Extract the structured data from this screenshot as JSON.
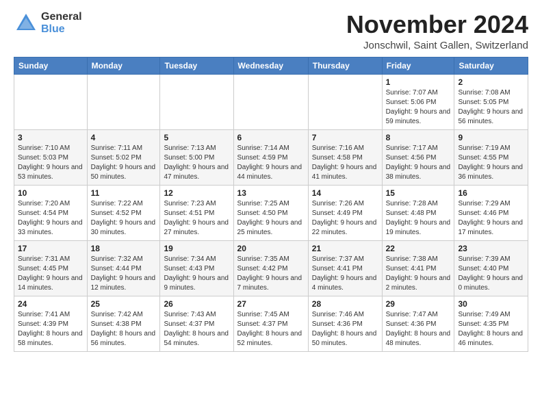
{
  "logo": {
    "general": "General",
    "blue": "Blue"
  },
  "title": "November 2024",
  "location": "Jonschwil, Saint Gallen, Switzerland",
  "weekdays": [
    "Sunday",
    "Monday",
    "Tuesday",
    "Wednesday",
    "Thursday",
    "Friday",
    "Saturday"
  ],
  "weeks": [
    [
      {
        "day": "",
        "info": ""
      },
      {
        "day": "",
        "info": ""
      },
      {
        "day": "",
        "info": ""
      },
      {
        "day": "",
        "info": ""
      },
      {
        "day": "",
        "info": ""
      },
      {
        "day": "1",
        "info": "Sunrise: 7:07 AM\nSunset: 5:06 PM\nDaylight: 9 hours and 59 minutes."
      },
      {
        "day": "2",
        "info": "Sunrise: 7:08 AM\nSunset: 5:05 PM\nDaylight: 9 hours and 56 minutes."
      }
    ],
    [
      {
        "day": "3",
        "info": "Sunrise: 7:10 AM\nSunset: 5:03 PM\nDaylight: 9 hours and 53 minutes."
      },
      {
        "day": "4",
        "info": "Sunrise: 7:11 AM\nSunset: 5:02 PM\nDaylight: 9 hours and 50 minutes."
      },
      {
        "day": "5",
        "info": "Sunrise: 7:13 AM\nSunset: 5:00 PM\nDaylight: 9 hours and 47 minutes."
      },
      {
        "day": "6",
        "info": "Sunrise: 7:14 AM\nSunset: 4:59 PM\nDaylight: 9 hours and 44 minutes."
      },
      {
        "day": "7",
        "info": "Sunrise: 7:16 AM\nSunset: 4:58 PM\nDaylight: 9 hours and 41 minutes."
      },
      {
        "day": "8",
        "info": "Sunrise: 7:17 AM\nSunset: 4:56 PM\nDaylight: 9 hours and 38 minutes."
      },
      {
        "day": "9",
        "info": "Sunrise: 7:19 AM\nSunset: 4:55 PM\nDaylight: 9 hours and 36 minutes."
      }
    ],
    [
      {
        "day": "10",
        "info": "Sunrise: 7:20 AM\nSunset: 4:54 PM\nDaylight: 9 hours and 33 minutes."
      },
      {
        "day": "11",
        "info": "Sunrise: 7:22 AM\nSunset: 4:52 PM\nDaylight: 9 hours and 30 minutes."
      },
      {
        "day": "12",
        "info": "Sunrise: 7:23 AM\nSunset: 4:51 PM\nDaylight: 9 hours and 27 minutes."
      },
      {
        "day": "13",
        "info": "Sunrise: 7:25 AM\nSunset: 4:50 PM\nDaylight: 9 hours and 25 minutes."
      },
      {
        "day": "14",
        "info": "Sunrise: 7:26 AM\nSunset: 4:49 PM\nDaylight: 9 hours and 22 minutes."
      },
      {
        "day": "15",
        "info": "Sunrise: 7:28 AM\nSunset: 4:48 PM\nDaylight: 9 hours and 19 minutes."
      },
      {
        "day": "16",
        "info": "Sunrise: 7:29 AM\nSunset: 4:46 PM\nDaylight: 9 hours and 17 minutes."
      }
    ],
    [
      {
        "day": "17",
        "info": "Sunrise: 7:31 AM\nSunset: 4:45 PM\nDaylight: 9 hours and 14 minutes."
      },
      {
        "day": "18",
        "info": "Sunrise: 7:32 AM\nSunset: 4:44 PM\nDaylight: 9 hours and 12 minutes."
      },
      {
        "day": "19",
        "info": "Sunrise: 7:34 AM\nSunset: 4:43 PM\nDaylight: 9 hours and 9 minutes."
      },
      {
        "day": "20",
        "info": "Sunrise: 7:35 AM\nSunset: 4:42 PM\nDaylight: 9 hours and 7 minutes."
      },
      {
        "day": "21",
        "info": "Sunrise: 7:37 AM\nSunset: 4:41 PM\nDaylight: 9 hours and 4 minutes."
      },
      {
        "day": "22",
        "info": "Sunrise: 7:38 AM\nSunset: 4:41 PM\nDaylight: 9 hours and 2 minutes."
      },
      {
        "day": "23",
        "info": "Sunrise: 7:39 AM\nSunset: 4:40 PM\nDaylight: 9 hours and 0 minutes."
      }
    ],
    [
      {
        "day": "24",
        "info": "Sunrise: 7:41 AM\nSunset: 4:39 PM\nDaylight: 8 hours and 58 minutes."
      },
      {
        "day": "25",
        "info": "Sunrise: 7:42 AM\nSunset: 4:38 PM\nDaylight: 8 hours and 56 minutes."
      },
      {
        "day": "26",
        "info": "Sunrise: 7:43 AM\nSunset: 4:37 PM\nDaylight: 8 hours and 54 minutes."
      },
      {
        "day": "27",
        "info": "Sunrise: 7:45 AM\nSunset: 4:37 PM\nDaylight: 8 hours and 52 minutes."
      },
      {
        "day": "28",
        "info": "Sunrise: 7:46 AM\nSunset: 4:36 PM\nDaylight: 8 hours and 50 minutes."
      },
      {
        "day": "29",
        "info": "Sunrise: 7:47 AM\nSunset: 4:36 PM\nDaylight: 8 hours and 48 minutes."
      },
      {
        "day": "30",
        "info": "Sunrise: 7:49 AM\nSunset: 4:35 PM\nDaylight: 8 hours and 46 minutes."
      }
    ]
  ]
}
